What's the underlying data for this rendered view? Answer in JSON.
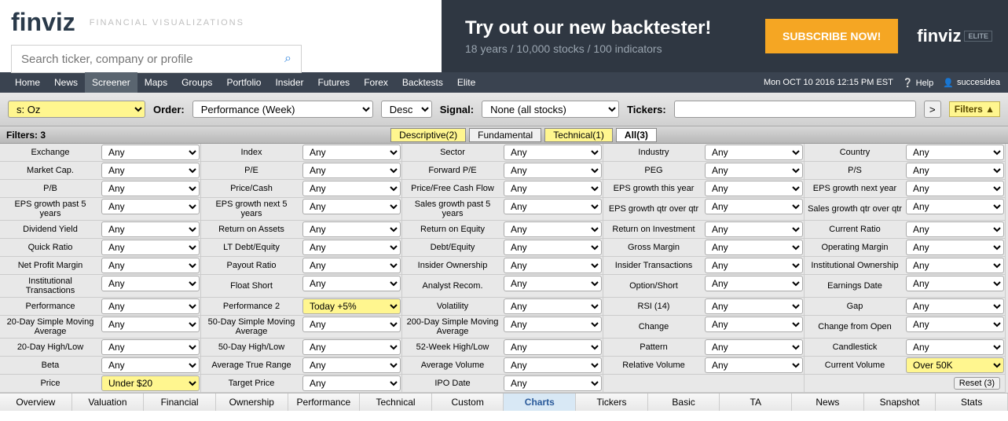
{
  "logo": "finviz",
  "logo_subtitle": "FINANCIAL VISUALIZATIONS",
  "search_placeholder": "Search ticker, company or profile",
  "banner": {
    "title": "Try out our new backtester!",
    "subtitle": "18 years / 10,000 stocks / 100 indicators",
    "button": "SUBSCRIBE NOW!",
    "elite_logo": "finviz",
    "elite_badge": "ELITE"
  },
  "nav": {
    "items": [
      "Home",
      "News",
      "Screener",
      "Maps",
      "Groups",
      "Portfolio",
      "Insider",
      "Futures",
      "Forex",
      "Backtests",
      "Elite"
    ],
    "active": 2,
    "datetime": "Mon OCT 10 2016 12:15 PM EST",
    "help": "Help",
    "user": "succesidea"
  },
  "filterbar": {
    "preset": "s: Oz",
    "order_label": "Order:",
    "order_value": "Performance (Week)",
    "direction": "Desc",
    "signal_label": "Signal:",
    "signal_value": "None (all stocks)",
    "tickers_label": "Tickers:",
    "go": ">",
    "filters_toggle": "Filters ▲"
  },
  "filter_tabs": {
    "count_label": "Filters:",
    "count_value": "3",
    "tabs": [
      "Descriptive(2)",
      "Fundamental",
      "Technical(1)",
      "All(3)"
    ]
  },
  "any": "Any",
  "filters": {
    "perf2": "Today +5%",
    "price": "Under $20",
    "curvol": "Over 50K"
  },
  "labels": {
    "r0": [
      "Exchange",
      "Index",
      "Sector",
      "Industry",
      "Country"
    ],
    "r1": [
      "Market Cap.",
      "P/E",
      "Forward P/E",
      "PEG",
      "P/S"
    ],
    "r2": [
      "P/B",
      "Price/Cash",
      "Price/Free Cash Flow",
      "EPS growth this year",
      "EPS growth next year"
    ],
    "r3": [
      "EPS growth past 5 years",
      "EPS growth next 5 years",
      "Sales growth past 5 years",
      "EPS growth qtr over qtr",
      "Sales growth qtr over qtr"
    ],
    "r4": [
      "Dividend Yield",
      "Return on Assets",
      "Return on Equity",
      "Return on Investment",
      "Current Ratio"
    ],
    "r5": [
      "Quick Ratio",
      "LT Debt/Equity",
      "Debt/Equity",
      "Gross Margin",
      "Operating Margin"
    ],
    "r6": [
      "Net Profit Margin",
      "Payout Ratio",
      "Insider Ownership",
      "Insider Transactions",
      "Institutional Ownership"
    ],
    "r7": [
      "Institutional Transactions",
      "Float Short",
      "Analyst Recom.",
      "Option/Short",
      "Earnings Date"
    ],
    "r8": [
      "Performance",
      "Performance 2",
      "Volatility",
      "RSI (14)",
      "Gap"
    ],
    "r9": [
      "20-Day Simple Moving Average",
      "50-Day Simple Moving Average",
      "200-Day Simple Moving Average",
      "Change",
      "Change from Open"
    ],
    "r10": [
      "20-Day High/Low",
      "50-Day High/Low",
      "52-Week High/Low",
      "Pattern",
      "Candlestick"
    ],
    "r11": [
      "Beta",
      "Average True Range",
      "Average Volume",
      "Relative Volume",
      "Current Volume"
    ],
    "r12": [
      "Price",
      "Target Price",
      "IPO Date",
      "",
      ""
    ]
  },
  "reset_label": "Reset (3)",
  "view_tabs": [
    "Overview",
    "Valuation",
    "Financial",
    "Ownership",
    "Performance",
    "Technical",
    "Custom",
    "Charts",
    "Tickers",
    "Basic",
    "TA",
    "News",
    "Snapshot",
    "Stats"
  ],
  "view_active": 7
}
